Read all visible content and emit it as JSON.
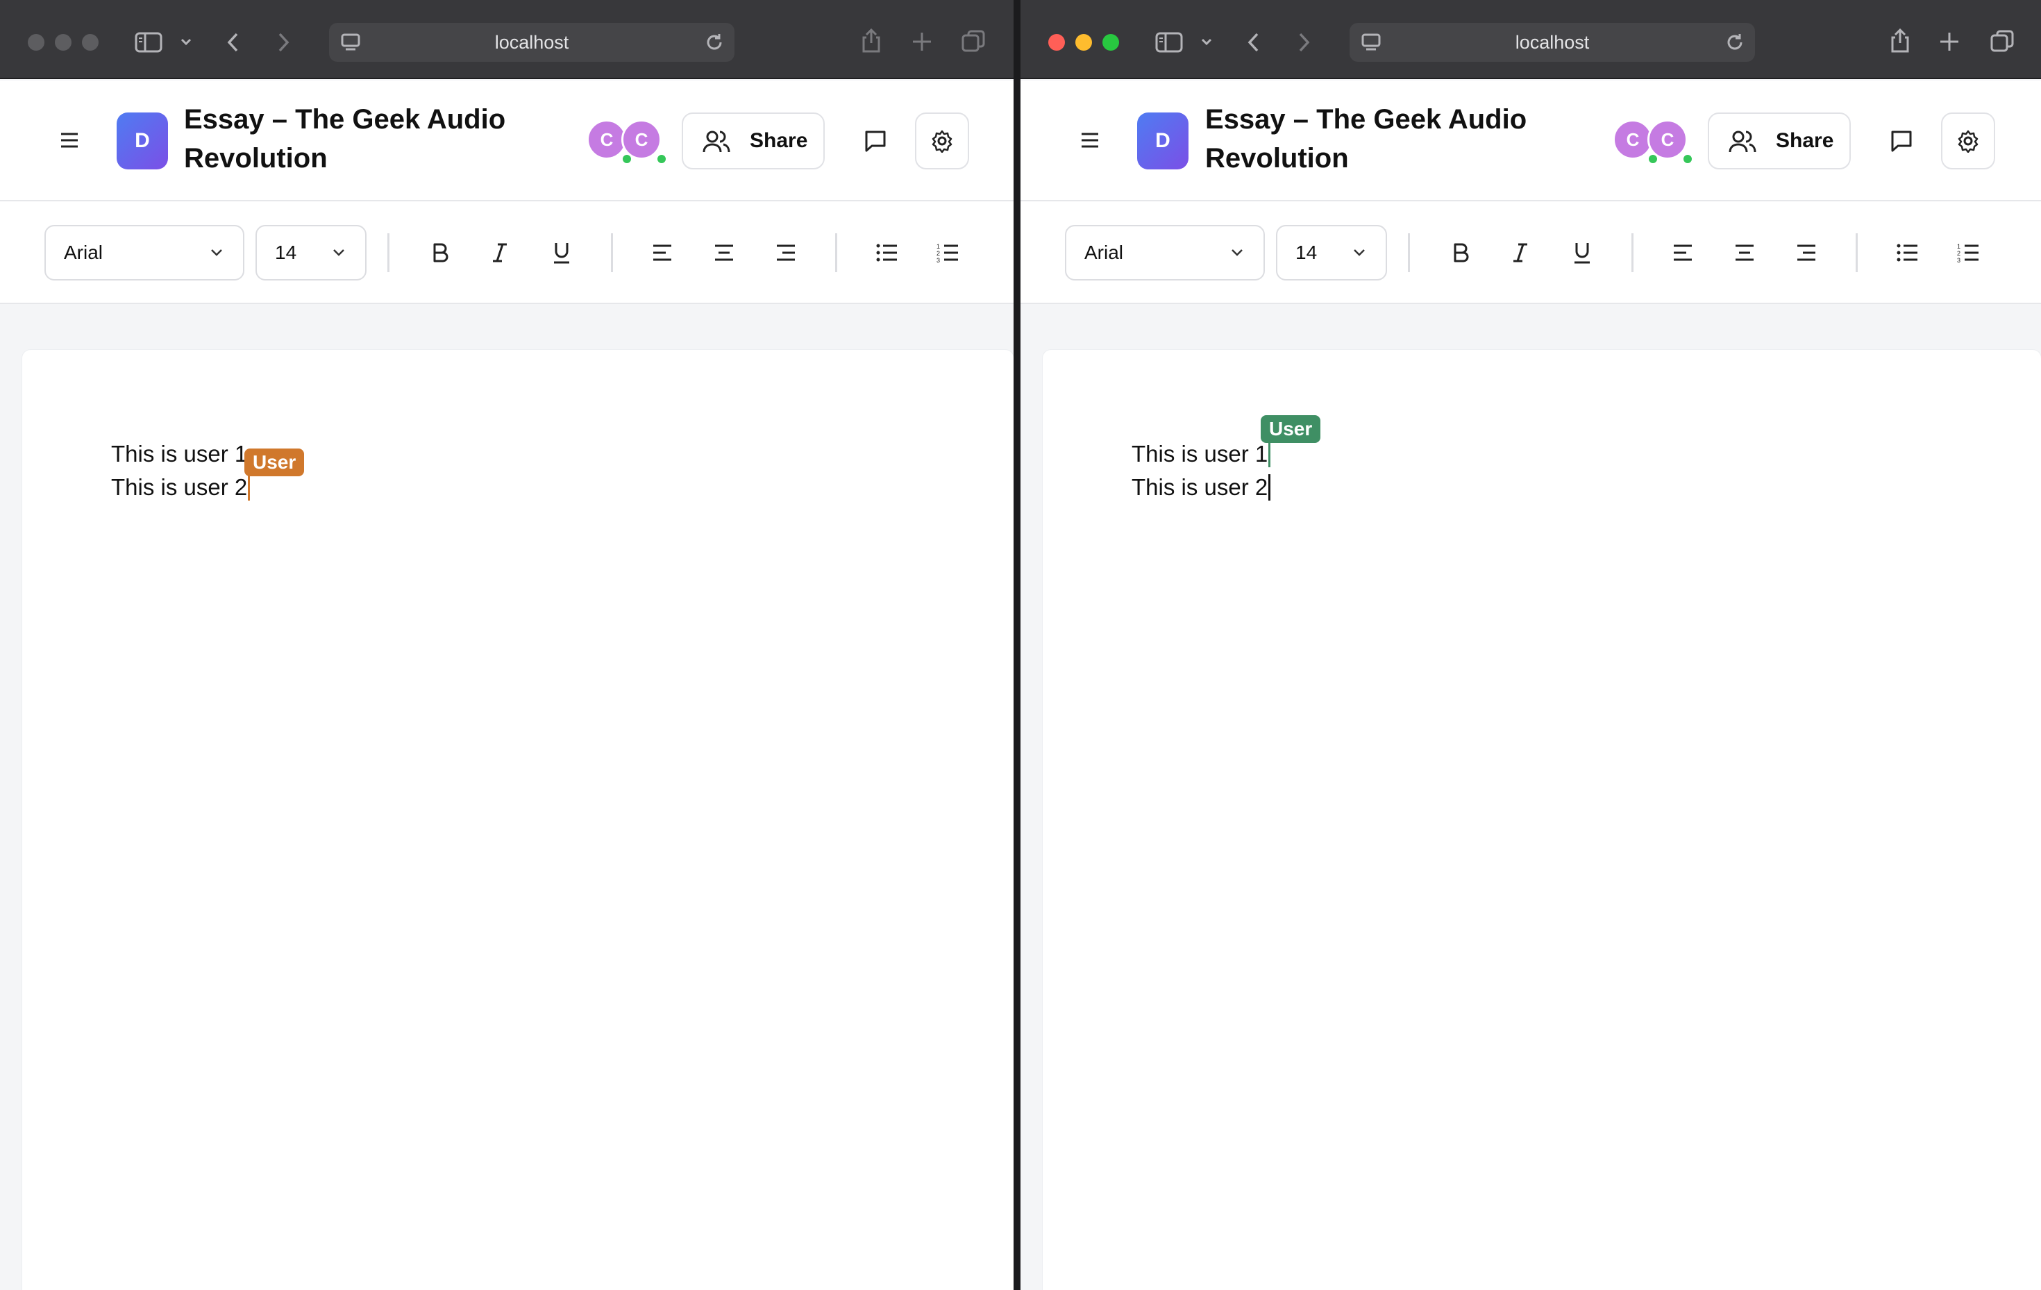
{
  "browser": {
    "url": "localhost"
  },
  "app": {
    "logo_letter": "D",
    "title_line1": "Essay – The Geek Audio",
    "title_line2": "Revolution",
    "collaborators": [
      {
        "initial": "C",
        "color": "#c57be2",
        "online": true
      },
      {
        "initial": "C",
        "color": "#c57be2",
        "online": true
      }
    ],
    "share_label": "Share"
  },
  "toolbar": {
    "font_family": "Arial",
    "font_size": "14"
  },
  "document": {
    "lines": [
      "This is user 1",
      "This is user 2"
    ],
    "cursor_label": "User"
  },
  "windows": [
    {
      "id": "left",
      "remote_cursor_color": "#d0782c",
      "remote_cursor_line": 2,
      "traffic_lights_active": false
    },
    {
      "id": "right",
      "remote_cursor_color": "#3f8f64",
      "remote_cursor_line": 1,
      "traffic_lights_active": true
    }
  ],
  "colors": {
    "traffic_close": "#ff5f57",
    "traffic_minimize": "#febc2e",
    "traffic_zoom": "#28c840",
    "online": "#35c759"
  }
}
